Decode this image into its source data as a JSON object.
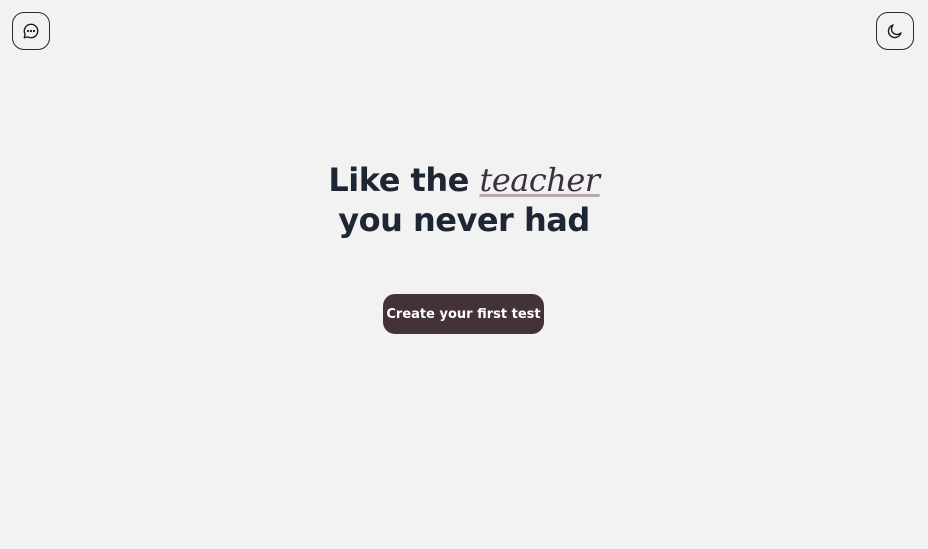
{
  "header": {
    "left_icon": "chat-bubble-icon",
    "right_icon": "moon-icon"
  },
  "hero": {
    "line1_prefix": "Like the",
    "line1_accent": "teacher",
    "line2": "you never had"
  },
  "cta": {
    "label": "Create your first test"
  },
  "colors": {
    "background": "#f2f2f2",
    "text": "#1e2533",
    "button_bg": "#433338",
    "button_text": "#ffffff",
    "accent_underline": "#b8a9b0"
  }
}
